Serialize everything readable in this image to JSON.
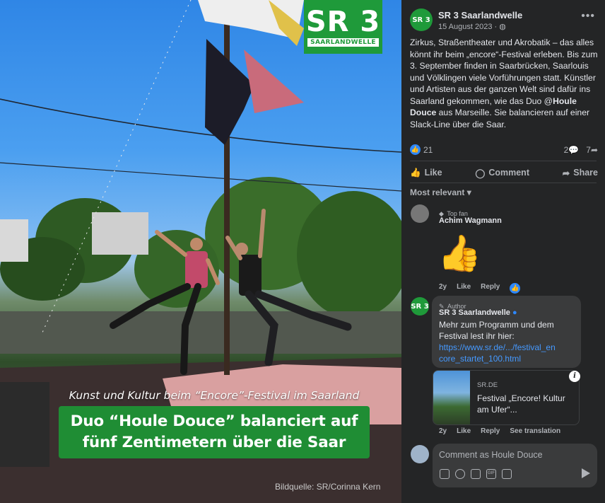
{
  "photo": {
    "logo_big": "SR 3",
    "logo_small": "SAARLANDWELLE",
    "caption_top": "Kunst und Kultur beim “Encore”-Festival  im Saarland",
    "caption_line1": "Duo “Houle Douce” balanciert auf",
    "caption_line2": "fünf Zentimetern über die Saar",
    "credit": "Bildquelle: SR/Corinna Kern"
  },
  "post": {
    "page_name": "SR 3 Saarlandwelle",
    "date": "15 August 2023 ·",
    "avatar_text": "SR 3",
    "text_part1": "Zirkus, Straßentheater und Akrobatik – das alles könnt ihr beim „encore“-Festival erleben. Bis zum 3. September finden in Saarbrücken, Saarlouis und Völklingen viele Vorführungen statt. Künstler und Artisten aus der ganzen Welt sind dafür ins Saarland gekommen, wie das Duo @",
    "text_mention": "Houle Douce",
    "text_part2": " aus Marseille. Sie balancieren auf einer Slack-Line über die Saar.",
    "reaction_count": "21",
    "comment_count": "2",
    "share_count": "7",
    "actions": {
      "like": "Like",
      "comment": "Comment",
      "share": "Share"
    },
    "sort_label": "Most relevant"
  },
  "comments": [
    {
      "badge": "Top fan",
      "name": "Achim Wagmann",
      "emoji": "👍",
      "time": "2y",
      "like": "Like",
      "reply": "Reply"
    },
    {
      "badge": "Author",
      "name": "SR 3 Saarlandwelle",
      "text": "Mehr zum Programm und dem Festival lest ihr hier:",
      "link_line1": "https://www.sr.de/.../festival_en",
      "link_line2": "core_startet_100.html",
      "preview_site": "SR.DE",
      "preview_title": "Festival „Encore! Kultur am Ufer“...",
      "time": "2y",
      "like": "Like",
      "reply": "Reply",
      "translate": "See translation"
    }
  ],
  "composer": {
    "placeholder": "Comment as Houle Douce"
  }
}
